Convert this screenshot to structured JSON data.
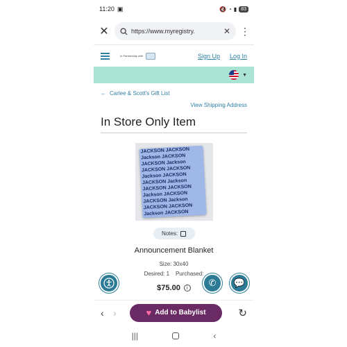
{
  "status": {
    "time": "11:20",
    "battery": "83"
  },
  "browser": {
    "url": "https://www.myregistry."
  },
  "site": {
    "partner_text": "In Partnership with",
    "sign_up": "Sign Up",
    "log_in": "Log In"
  },
  "page": {
    "back_label": "Carlee & Scott's Gift List",
    "shipping_link": "View Shipping Address",
    "title": "In Store Only Item",
    "notes_label": "Notes:",
    "product_name": "Announcement Blanket",
    "size": "Size: 30x40",
    "desired": "Desired: 1",
    "purchased": "Purchased:",
    "price": "$75.00"
  },
  "bottombar": {
    "cta_label": "Add to Babylist"
  },
  "colors": {
    "accent": "#2d7fa3",
    "mint": "#a8e3d3",
    "cta": "#6a2a64",
    "fab": "#2b7a96"
  },
  "icons": [
    "close-icon",
    "search-icon",
    "clear-icon",
    "kebab-menu-icon",
    "hamburger-icon",
    "us-flag-icon",
    "back-arrow-icon",
    "notes-icon",
    "info-icon",
    "accessibility-icon",
    "phone-icon",
    "chat-icon",
    "heart-icon",
    "reload-icon"
  ]
}
